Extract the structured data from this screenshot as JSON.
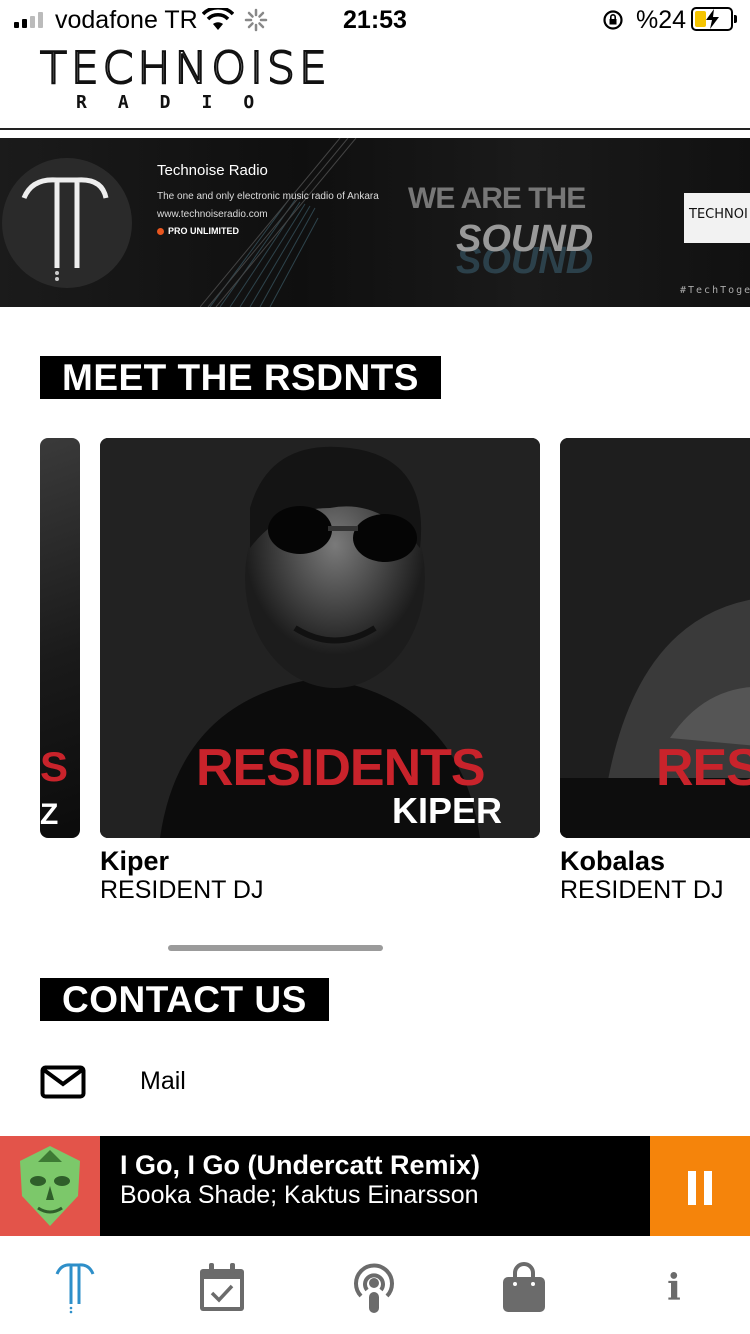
{
  "status_bar": {
    "carrier": "vodafone TR",
    "time": "21:53",
    "battery_percent": "%24",
    "battery_level": 0.24,
    "signal_bars_active": 2
  },
  "header": {
    "logo_title": "TECHNOISE",
    "logo_subtitle": "RADIO"
  },
  "banner": {
    "title": "Technoise Radio",
    "description": "The one and only electronic music radio of Ankara",
    "url": "www.technoiseradio.com",
    "pro": "PRO UNLIMITED",
    "slogan_top": "WE ARE THE",
    "slogan_bottom": "SOUND",
    "card_text": "TECHNOI",
    "hashtag": "#TechToge"
  },
  "residents": {
    "heading": "MEET THE RSDNTS",
    "items": [
      {
        "name": "Kiper",
        "role": "RESIDENT DJ",
        "card_word": "RESIDENTS",
        "card_name": "KIPER"
      },
      {
        "name": "Kobalas",
        "role": "RESIDENT DJ",
        "card_word": "RES"
      }
    ]
  },
  "contact": {
    "heading": "CONTACT US",
    "mail_label": "Mail"
  },
  "player": {
    "track": "I Go, I Go (Undercatt Remix)",
    "artist": "Booka Shade; Kaktus Einarsson"
  },
  "colors": {
    "accent_orange": "#f5840b",
    "art_red": "#e3544a",
    "tab_active": "#2e8fc9",
    "tab_inactive": "#6b6b6b",
    "residents_red": "#c9232b"
  },
  "tabs": [
    {
      "icon": "technoise-logo-icon",
      "active": true
    },
    {
      "icon": "calendar-icon",
      "active": false
    },
    {
      "icon": "podcast-icon",
      "active": false
    },
    {
      "icon": "shopping-bag-icon",
      "active": false
    },
    {
      "icon": "info-icon",
      "active": false
    }
  ]
}
